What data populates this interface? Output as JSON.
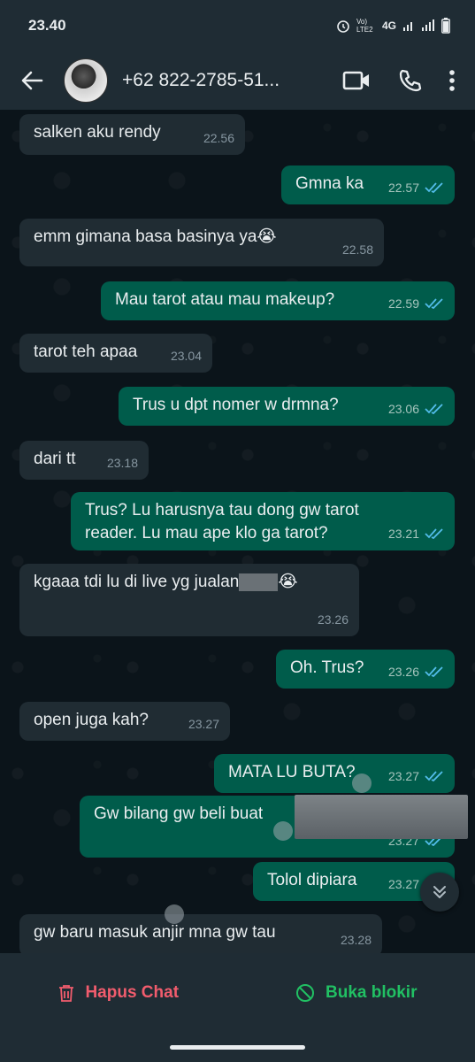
{
  "status_bar": {
    "time": "23.40",
    "network": "4G",
    "volte": "Vo) LTE2"
  },
  "header": {
    "contact": "+62 822-2785-51..."
  },
  "messages": [
    {
      "dir": "in",
      "text": "salken aku rendy",
      "time": "22.56"
    },
    {
      "dir": "out",
      "text": "Gmna ka",
      "time": "22.57"
    },
    {
      "dir": "in",
      "text": "emm gimana basa basinya ya",
      "emoji": "😭",
      "time": "22.58"
    },
    {
      "dir": "out",
      "text": "Mau tarot atau mau makeup?",
      "time": "22.59"
    },
    {
      "dir": "in",
      "text": "tarot teh apaa",
      "time": "23.04"
    },
    {
      "dir": "out",
      "text": "Trus u dpt nomer w drmna?",
      "time": "23.06"
    },
    {
      "dir": "in",
      "text": "dari tt",
      "time": "23.18"
    },
    {
      "dir": "out",
      "text": "Trus? Lu harusnya tau dong gw tarot",
      "text2": "reader. Lu mau ape klo ga tarot?",
      "time": "23.21"
    },
    {
      "dir": "in",
      "text": "kgaaa tdi lu di live yg jualan",
      "emoji": "😭",
      "time": "23.26"
    },
    {
      "dir": "out",
      "text": "Oh. Trus?",
      "time": "23.26"
    },
    {
      "dir": "in",
      "text": "open juga kah?",
      "time": "23.27"
    },
    {
      "dir": "out",
      "text": "MATA LU BUTA?",
      "time": "23.27"
    },
    {
      "dir": "out",
      "text": "Gw bilang gw beli buat",
      "time": "23.27"
    },
    {
      "dir": "out",
      "text": "Tolol dipiara",
      "time": "23.27"
    },
    {
      "dir": "in",
      "text": "gw baru masuk anjir mna gw tau",
      "time": "23.28"
    }
  ],
  "bottom_bar": {
    "delete_label": "Hapus Chat",
    "unblock_label": "Buka blokir"
  },
  "colors": {
    "incoming": "#202c33",
    "outgoing": "#005c4b",
    "read_tick": "#53bdeb",
    "delete": "#f15c6d",
    "unblock": "#21c063"
  },
  "icons": [
    "back-arrow-icon",
    "video-call-icon",
    "phone-icon",
    "more-vert-icon",
    "double-check-icon",
    "scroll-down-icon",
    "trash-icon",
    "unblock-icon"
  ]
}
